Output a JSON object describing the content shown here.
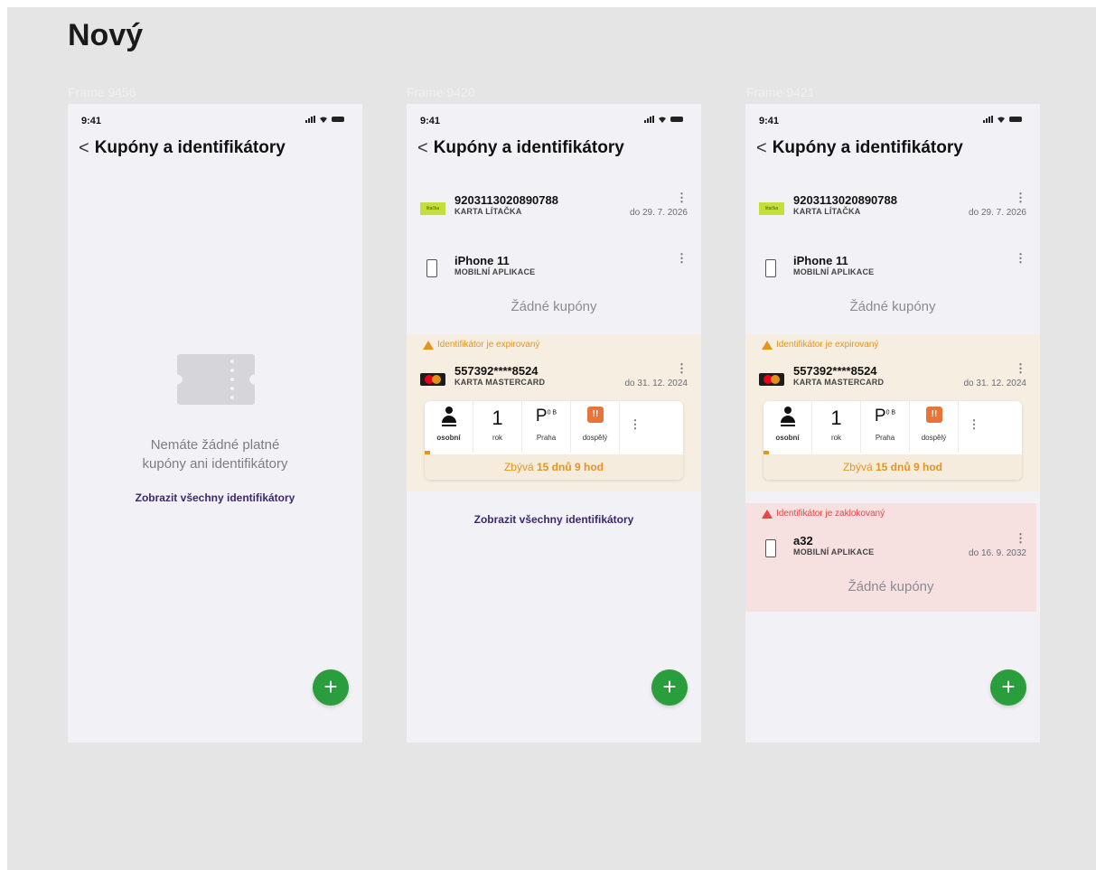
{
  "board": {
    "title": "Nový"
  },
  "frames": [
    {
      "label": "Frame 9456"
    },
    {
      "label": "Frame 9420"
    },
    {
      "label": "Frame 9421"
    }
  ],
  "status_bar": {
    "time": "9:41"
  },
  "nav": {
    "back": "<",
    "title": "Kupóny a identifikátory"
  },
  "empty_state": {
    "line1": "Nemáte žádné platné",
    "line2": "kupóny ani identifikátory",
    "link": "Zobrazit všechny identifikátory"
  },
  "cards": {
    "litacka": {
      "logo_text": "lítačka",
      "number": "9203113020890788",
      "type": "KARTA LÍTAČKA",
      "validity": "do 29. 7. 2026"
    },
    "iphone": {
      "name": "iPhone 11",
      "type": "MOBILNÍ APLIKACE"
    },
    "mastercard": {
      "number": "557392****8524",
      "type": "KARTA MASTERCARD",
      "validity": "do 31. 12. 2024"
    },
    "a32": {
      "name": "a32",
      "type": "MOBILNÍ APLIKACE",
      "validity": "do 16. 9. 2032"
    },
    "menu": "⋮"
  },
  "no_coupons": "Žádné kupóny",
  "warnings": {
    "expired": "Identifikátor je expirovaný",
    "locked": "Identifikátor je zaklokovaný"
  },
  "ticket": {
    "holder_label": "osobní",
    "duration_value": "1",
    "duration_label": "rok",
    "zone_value": "P",
    "zone_sup": "0 B",
    "zone_label": "Praha",
    "age_icon": "!!",
    "age_label": "dospělý",
    "remaining_prefix": "Zbývá",
    "remaining_value": "15 dnů 9 hod",
    "progress": 0.02
  },
  "link_all": "Zobrazit všechny identifikátory",
  "fab": "+",
  "colors": {
    "fab": "#2a9d3c",
    "warning": "#e6941e",
    "locked": "#e84545",
    "link": "#3a2970"
  }
}
